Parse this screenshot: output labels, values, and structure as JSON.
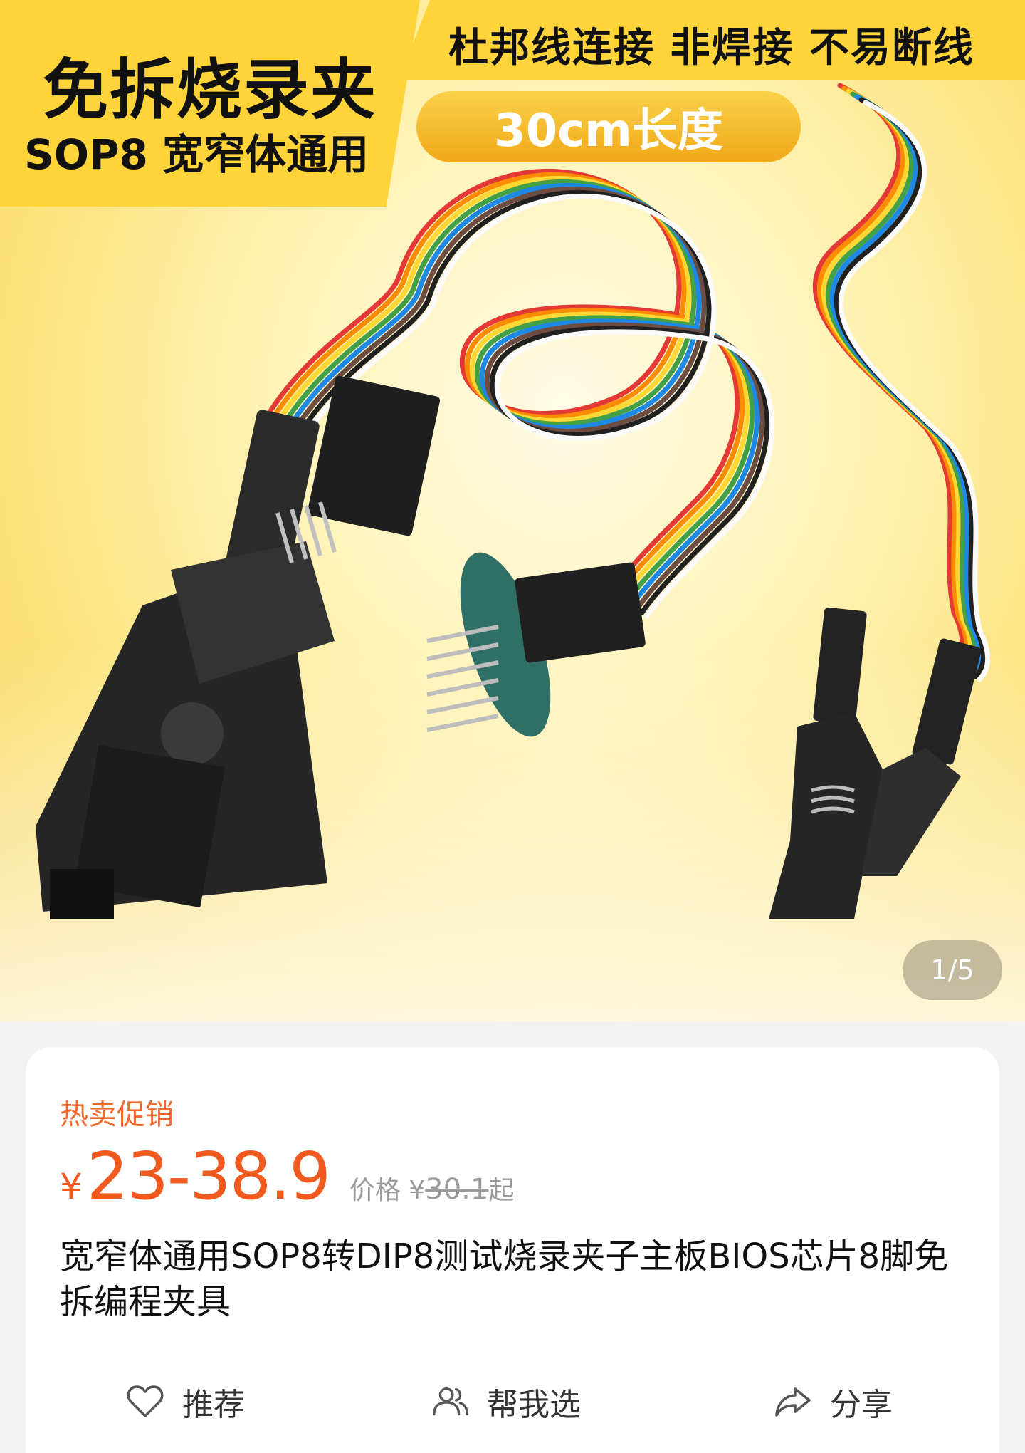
{
  "banner": {
    "title": "免拆烧录夹",
    "subtitle": "SOP8 宽窄体通用",
    "features": "杜邦线连接  非焊接  不易断线",
    "length_badge": "30cm长度"
  },
  "gallery": {
    "counter": "1/5"
  },
  "product": {
    "promo_label": "热卖促销",
    "currency": "¥",
    "price_range": "23-38.9",
    "original_label": "价格 ¥",
    "original_price": "30.1",
    "original_suffix": "起",
    "title": "宽窄体通用SOP8转DIP8测试烧录夹子主板BIOS芯片8脚免拆编程夹具"
  },
  "actions": [
    {
      "label": "推荐",
      "icon": "heart-icon"
    },
    {
      "label": "帮我选",
      "icon": "users-icon"
    },
    {
      "label": "分享",
      "icon": "share-icon"
    }
  ],
  "colors": {
    "accent_orange": "#f05a1e",
    "promo_orange": "#f0692c",
    "banner_yellow": "#fed43a"
  }
}
